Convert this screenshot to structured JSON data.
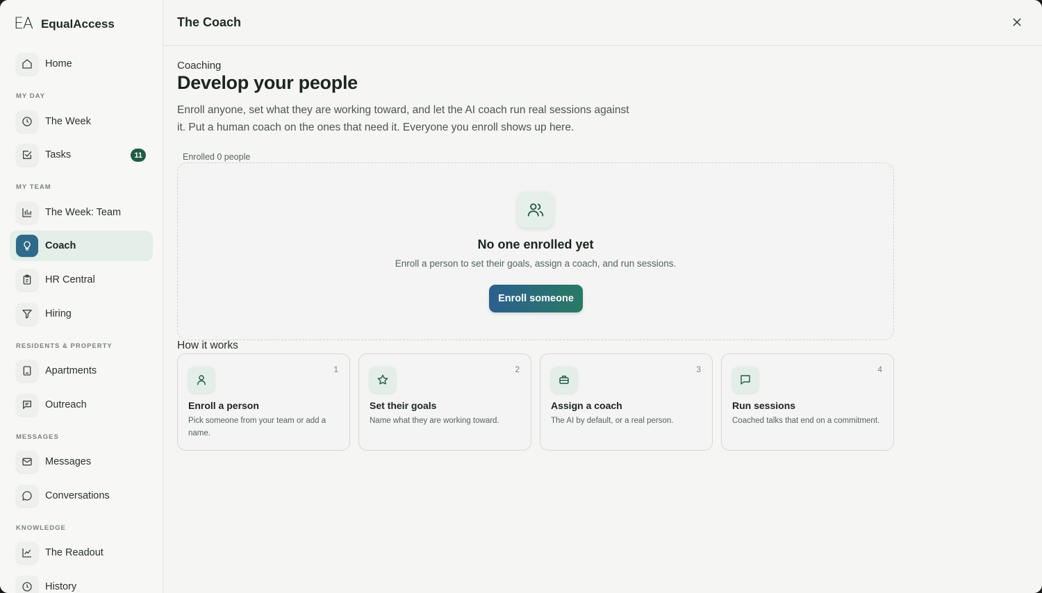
{
  "brand": {
    "logo": "EA",
    "name": "EqualAccess"
  },
  "sidebar": {
    "home": {
      "label": "Home",
      "icon": "home-icon"
    },
    "sections": {
      "my_day": "MY DAY",
      "my_team": "MY TEAM",
      "residents": "RESIDENTS & PROPERTY",
      "messages": "MESSAGES",
      "knowledge": "KNOWLEDGE"
    },
    "items": {
      "the_week": {
        "label": "The Week",
        "icon": "clock-icon"
      },
      "tasks": {
        "label": "Tasks",
        "icon": "checkbox-icon",
        "badge": "11"
      },
      "the_week_team": {
        "label": "The Week: Team",
        "icon": "bar-chart-icon"
      },
      "coach": {
        "label": "Coach",
        "icon": "lightbulb-icon",
        "active": true
      },
      "hr_central": {
        "label": "HR Central",
        "icon": "clipboard-icon"
      },
      "hiring": {
        "label": "Hiring",
        "icon": "filter-icon"
      },
      "apartments": {
        "label": "Apartments",
        "icon": "building-icon"
      },
      "outreach": {
        "label": "Outreach",
        "icon": "message-square-icon"
      },
      "messages": {
        "label": "Messages",
        "icon": "mail-icon"
      },
      "conversations": {
        "label": "Conversations",
        "icon": "chat-bubble-icon"
      },
      "the_readout": {
        "label": "The Readout",
        "icon": "line-chart-icon"
      },
      "history": {
        "label": "History",
        "icon": "clock-icon"
      }
    }
  },
  "header": {
    "title": "The Coach",
    "close_icon": "close-icon"
  },
  "main": {
    "eyebrow": "Coaching",
    "headline": "Develop your people",
    "lede": "Enroll anyone, set what they are working toward, and let the AI coach run real sessions against it. Put a human coach on the ones that need it. Everyone you enroll shows up here.",
    "enrolled_label": "Enrolled 0 people",
    "empty_state": {
      "icon": "users-icon",
      "title": "No one enrolled yet",
      "subtitle": "Enroll a person to set their goals, assign a coach, and run sessions.",
      "button": "Enroll someone"
    },
    "how_it_works": {
      "title": "How it works",
      "steps": [
        {
          "num": "1",
          "icon": "user-icon",
          "title": "Enroll a person",
          "desc": "Pick someone from your team or add a name."
        },
        {
          "num": "2",
          "icon": "star-icon",
          "title": "Set their goals",
          "desc": "Name what they are working toward."
        },
        {
          "num": "3",
          "icon": "briefcase-icon",
          "title": "Assign a coach",
          "desc": "The AI by default, or a real person."
        },
        {
          "num": "4",
          "icon": "chat-bubble-icon",
          "title": "Run sessions",
          "desc": "Coached talks that end on a commitment."
        }
      ]
    }
  },
  "colors": {
    "accent_green": "#1e5c44",
    "accent_blue": "#2e6a8a",
    "active_bg": "#e3efe8"
  }
}
